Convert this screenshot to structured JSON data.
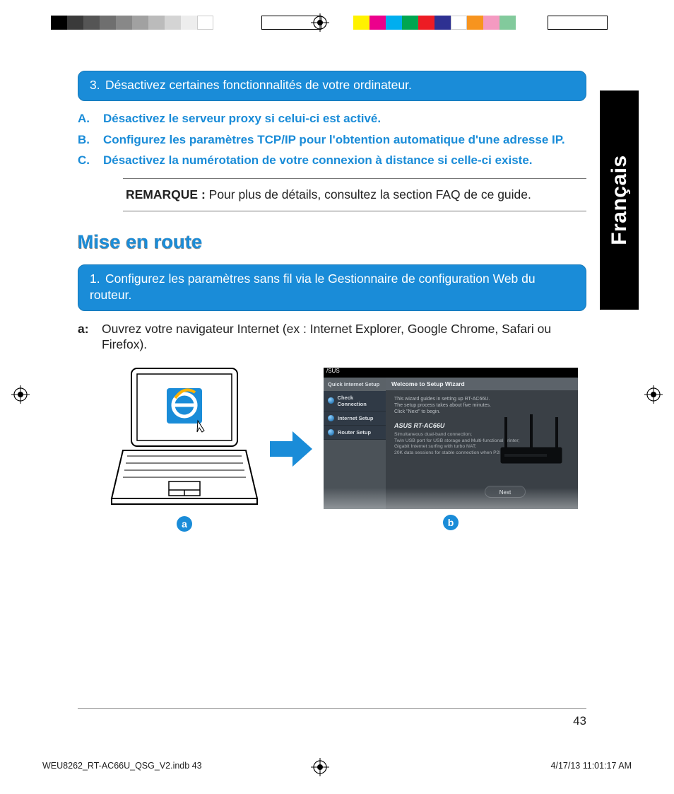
{
  "calib_left": [
    "#000000",
    "#3a3a3a",
    "#555555",
    "#6f6f6f",
    "#888888",
    "#a1a1a1",
    "#bbbbbb",
    "#d4d4d4",
    "#ededed",
    "#ffffff",
    "#ffffff",
    "#ffffff",
    "#ffffff"
  ],
  "calib_right": [
    "#fff200",
    "#ec008c",
    "#00aeef",
    "#00a651",
    "#ed1c24",
    "#2e3192",
    "#ffffff",
    "#f7941e",
    "#f49ac1",
    "#82ca9c",
    "#ffffff",
    "#ffffff"
  ],
  "language_tab": "Français",
  "step3": "Désactivez certaines fonctionnalités de votre ordinateur.",
  "subA_label": "A.",
  "subA": "Désactivez le serveur proxy si celui-ci est activé.",
  "subB_label": "B.",
  "subB": "Configurez les paramètres TCP/IP pour l'obtention automatique d'une adresse IP.",
  "subC_label": "C.",
  "subC": "Désactivez la numérotation de votre connexion à distance si celle-ci existe.",
  "note_bold": "REMARQUE :",
  "note_rest": " Pour plus de détails, consultez la section FAQ de ce guide.",
  "heading": "Mise en route",
  "step1": "Configurez les paramètres sans fil via le Gestionnaire de configuration Web du routeur.",
  "a_label": "a:",
  "a_text": "Ouvrez votre navigateur Internet (ex : Internet Explorer, Google Chrome, Safari ou Firefox).",
  "wizard": {
    "brand": "/SUS",
    "side_hdr": "Quick Internet Setup",
    "side_rows": [
      "Check Connection",
      "Internet Setup",
      "Router Setup"
    ],
    "title": "Welcome to Setup Wizard",
    "intro1": "This wizard guides in setting up RT-AC66U.",
    "intro2": "The setup process takes about five minutes.",
    "intro3": "Click \"Next\" to begin.",
    "model": "ASUS RT-AC66U",
    "feat1": "Simultaneous dual-band connection;",
    "feat2": "Twin USB port for USB storage and Multi-functional printer;",
    "feat3": "Gigabit Internet surfing with turbo NAT;",
    "feat4": "20K data sessions for stable connection when P2P downloading.",
    "next": "Next"
  },
  "badge_a": "a",
  "badge_b": "b",
  "page_number": "43",
  "footer_filename": "WEU8262_RT-AC66U_QSG_V2.indb   43",
  "footer_datetime": "4/17/13   11:01:17 AM"
}
